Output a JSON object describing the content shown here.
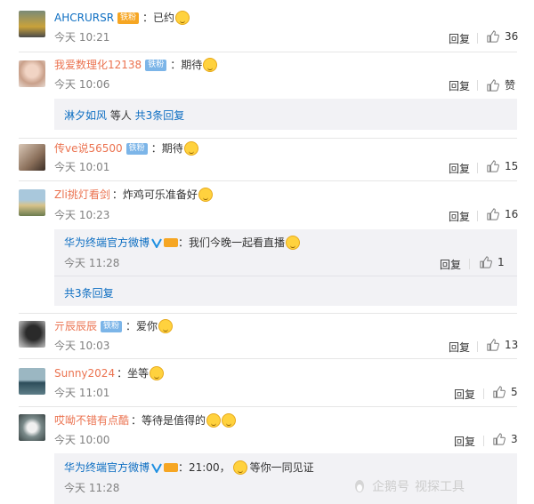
{
  "comments": [
    {
      "name": "AHCRURSR",
      "badge": "铁粉",
      "text": "：已约",
      "time": "今天 10:21",
      "reply": "回复",
      "likes": "36"
    },
    {
      "name": "我爱数理化12138",
      "badge": "铁粉",
      "text": "：期待",
      "time": "今天 10:06",
      "reply": "回复",
      "likes": "赞",
      "more": {
        "user": "淋夕如风",
        "middle": " 等人 ",
        "link": "共3条回复"
      }
    },
    {
      "name": "传ve说56500",
      "badge": "铁粉",
      "text": "：期待",
      "time": "今天 10:01",
      "reply": "回复",
      "likes": "15"
    },
    {
      "name": "Zli挑灯看剑",
      "text": "：炸鸡可乐准备好",
      "time": "今天 10:23",
      "reply": "回复",
      "likes": "16",
      "sub": {
        "name": "华为终端官方微博",
        "text": "：我们今晚一起看直播",
        "time": "今天 11:28",
        "reply": "回复",
        "likes": "1"
      },
      "more_link": "共3条回复"
    },
    {
      "name": "亓辰辰辰",
      "badge": "铁粉",
      "text": "：爱你",
      "time": "今天 10:03",
      "reply": "回复",
      "likes": "13"
    },
    {
      "name": "Sunny2024",
      "text": "：坐等",
      "time": "今天 11:01",
      "reply": "回复",
      "likes": "5"
    },
    {
      "name": "哎呦不错有点酷",
      "text": "：等待是值得的",
      "time": "今天 10:00",
      "reply": "回复",
      "likes": "3",
      "sub": {
        "name": "华为终端官方微博",
        "text_a": "：21:00，",
        "text_b": "等你一同见证",
        "time": "今天 11:28"
      }
    }
  ],
  "watermark": {
    "a": "企鹅号",
    "b": "视探工具"
  },
  "colors": {
    "name": "#eb7350",
    "link": "#0d6ec2",
    "badge": "#7cb5e8",
    "subbg": "#f2f2f5"
  }
}
